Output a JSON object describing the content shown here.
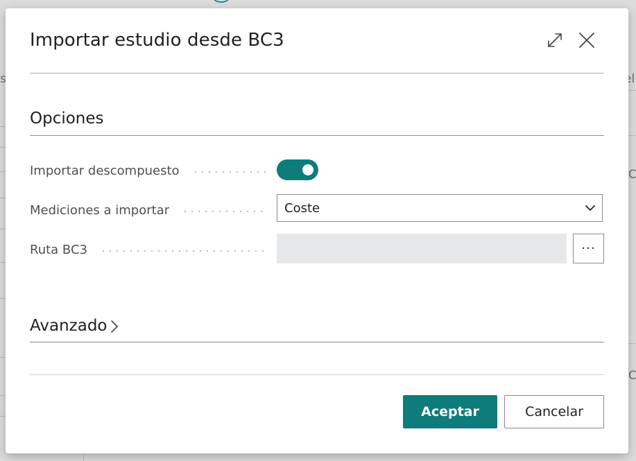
{
  "background": {
    "fragments": [
      "s",
      "el",
      "C",
      "C"
    ]
  },
  "dialog": {
    "title": "Importar estudio desde BC3",
    "expand_icon": "expand-diagonal-icon",
    "close_icon": "close-x-icon"
  },
  "options": {
    "section_title": "Opciones",
    "importar_descompuesto": {
      "label": "Importar descompuesto",
      "value": true
    },
    "mediciones": {
      "label": "Mediciones a importar",
      "selected": "Coste"
    },
    "ruta_bc3": {
      "label": "Ruta BC3",
      "value": "",
      "lookup_label": "···"
    }
  },
  "advanced": {
    "section_title": "Avanzado",
    "expanded": false
  },
  "footer": {
    "ok_label": "Aceptar",
    "cancel_label": "Cancelar"
  },
  "colors": {
    "accent": "#0e7c7b",
    "field_disabled": "#e6e7e8"
  }
}
